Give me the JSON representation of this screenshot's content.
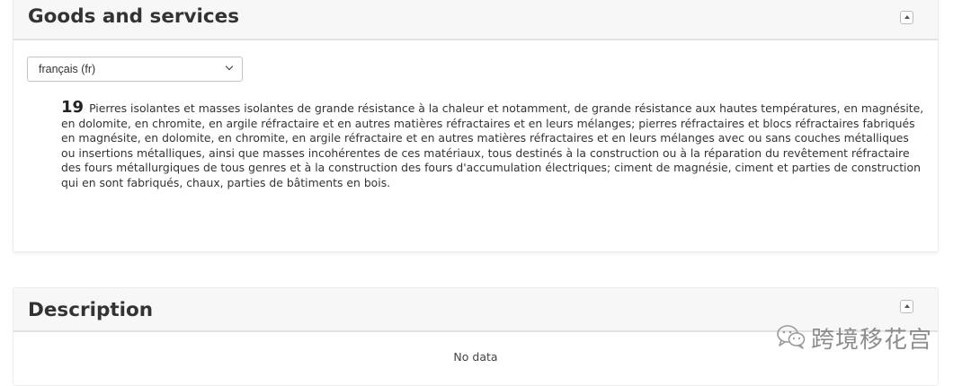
{
  "goods_panel": {
    "title": "Goods and services",
    "language_select": {
      "selected": "français (fr)"
    },
    "entry": {
      "class_number": "19",
      "text": "Pierres isolantes et masses isolantes de grande résistance à la chaleur et notamment, de grande résistance aux hautes températures, en magnésite, en dolomite, en chromite, en argile réfractaire et en autres matières réfractaires et en leurs mélanges; pierres réfractaires et blocs réfractaires fabriqués en magnésite, en dolomite, en chromite, en argile réfractaire et en autres matières réfractaires et en leurs mélanges avec ou sans couches métalliques ou insertions métalliques, ainsi que masses incohérentes de ces matériaux, tous destinés à la construction ou à la réparation du revêtement réfractaire des fours métallurgiques de tous genres et à la construction des fours d'accumulation électriques; ciment de magnésie, ciment et parties de construction qui en sont fabriqués, chaux, parties de bâtiments en bois."
    }
  },
  "description_panel": {
    "title": "Description",
    "empty_text": "No data"
  },
  "watermark": {
    "icon": "wechat-icon",
    "text": "跨境移花宫"
  }
}
